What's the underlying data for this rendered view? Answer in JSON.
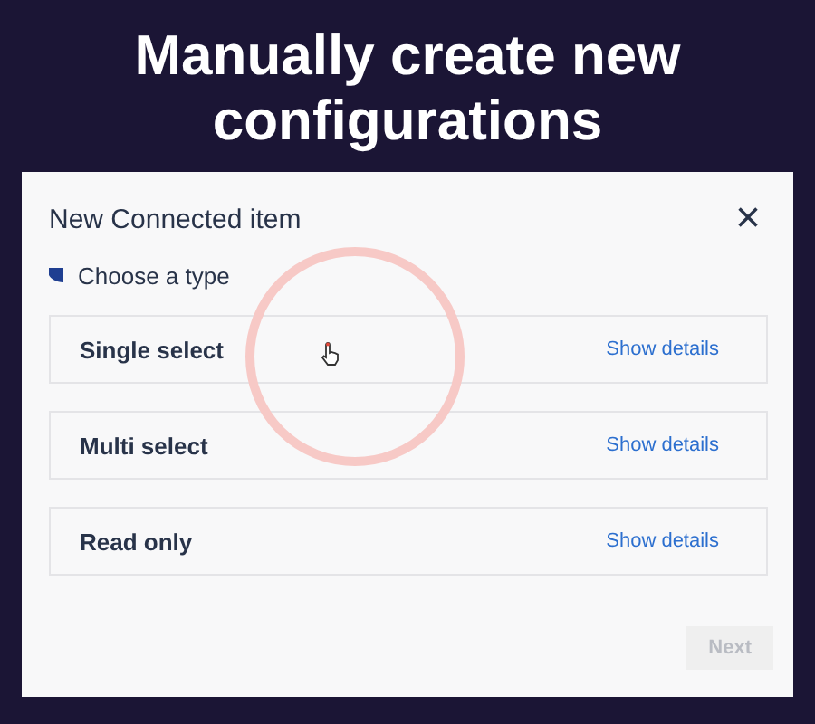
{
  "headline": "Manually create new configurations",
  "dialog": {
    "title": "New Connected item",
    "close": "×",
    "step": "Choose a type",
    "options": [
      {
        "label": "Single select",
        "link": "Show details"
      },
      {
        "label": "Multi select",
        "link": "Show details"
      },
      {
        "label": "Read only",
        "link": "Show details"
      }
    ],
    "next": {
      "label": "Next",
      "disabled": true
    }
  }
}
